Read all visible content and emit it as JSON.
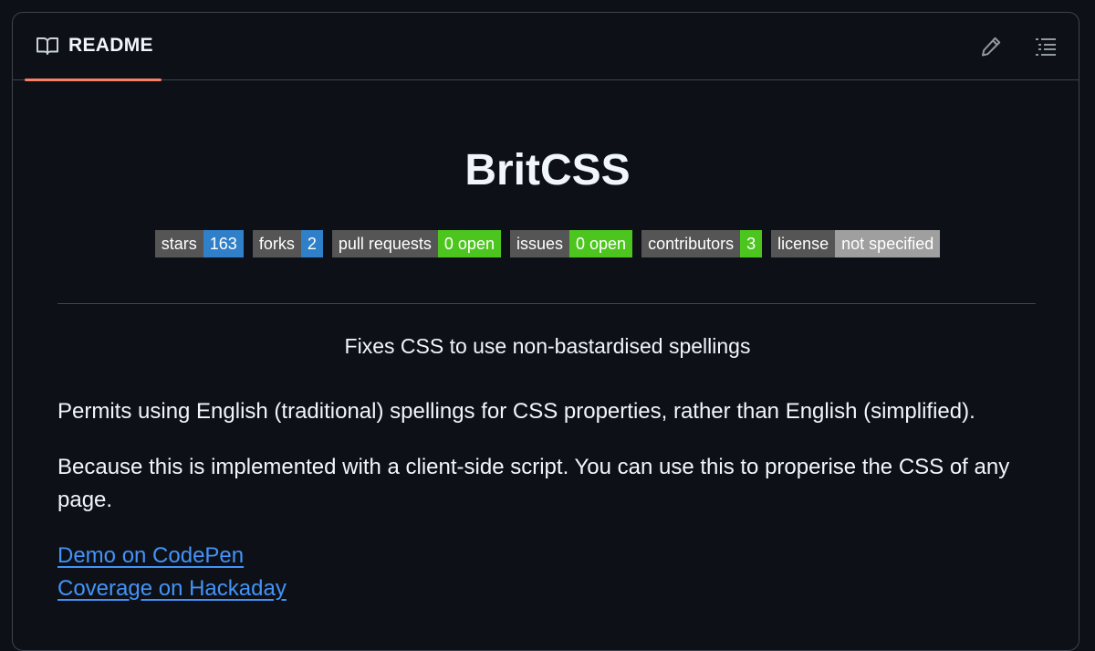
{
  "header": {
    "tab_label": "README",
    "edit_icon": "pencil-icon",
    "outline_icon": "list-icon",
    "book_icon": "book-icon",
    "accent_color": "#f78166"
  },
  "readme": {
    "title": "BritCSS",
    "badges": [
      {
        "label": "stars",
        "value": "163",
        "color": "#2f7fc9"
      },
      {
        "label": "forks",
        "value": "2",
        "color": "#2f7fc9"
      },
      {
        "label": "pull requests",
        "value": "0 open",
        "color": "#4cc61e"
      },
      {
        "label": "issues",
        "value": "0 open",
        "color": "#4cc61e"
      },
      {
        "label": "contributors",
        "value": "3",
        "color": "#4cc61e"
      },
      {
        "label": "license",
        "value": "not specified",
        "color": "#9f9f9f"
      }
    ],
    "tagline": "Fixes CSS to use non-bastardised spellings",
    "paragraphs": [
      "Permits using English (traditional) spellings for CSS properties, rather than English (simplified).",
      "Because this is implemented with a client-side script. You can use this to properise the CSS of any page."
    ],
    "links": [
      "Demo on CodePen",
      "Coverage on Hackaday"
    ]
  }
}
